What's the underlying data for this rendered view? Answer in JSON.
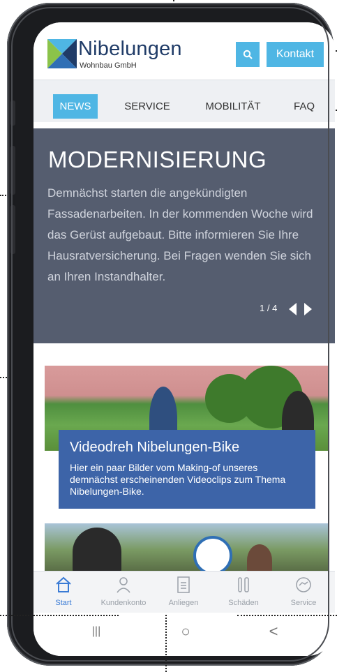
{
  "header": {
    "brand_name": "Nibelungen",
    "brand_sub": "Wohnbau GmbH",
    "search_icon": "search-icon",
    "contact_label": "Kontakt"
  },
  "nav": {
    "items": [
      {
        "label": "NEWS",
        "active": true
      },
      {
        "label": "SERVICE",
        "active": false
      },
      {
        "label": "MOBILITÄT",
        "active": false
      },
      {
        "label": "FAQ",
        "active": false
      }
    ]
  },
  "hero": {
    "title": "MODERNISIERUNG",
    "text": "Demnächst starten die angekündigten Fassadenarbeiten. In der kommenden Woche wird das Gerüst aufgebaut. Bitte informieren Sie Ihre Hausratversicherung. Bei Fragen wenden Sie sich an Ihren Instandhalter.",
    "pager": "1 / 4"
  },
  "cards": [
    {
      "title": "Videodreh Nibelungen-Bike",
      "description": "Hier ein paar Bilder vom Making-of unseres demnächst erscheinenden Videoclips zum Thema Nibelungen-Bike."
    }
  ],
  "tabbar": {
    "items": [
      {
        "label": "Start",
        "icon": "home-icon",
        "active": true
      },
      {
        "label": "Kundenkonto",
        "icon": "user-icon",
        "active": false
      },
      {
        "label": "Anliegen",
        "icon": "document-icon",
        "active": false
      },
      {
        "label": "Schäden",
        "icon": "tools-icon",
        "active": false
      },
      {
        "label": "Service",
        "icon": "handshake-icon",
        "active": false
      }
    ]
  },
  "system_nav": {
    "recent": "|||",
    "home": "○",
    "back": "<"
  },
  "colors": {
    "accent": "#4fb6e4",
    "hero_bg": "#555d6f",
    "caption_bg": "#3d64a8",
    "tab_active": "#3a7bd5"
  }
}
